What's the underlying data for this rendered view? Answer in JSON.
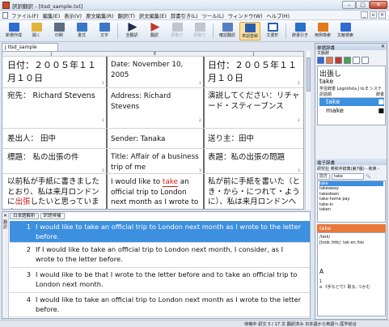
{
  "window": {
    "title": "訳訳翻訳 - [Itsd_sample.txt]",
    "min": "–",
    "max": "□",
    "close": "✕"
  },
  "menu": {
    "items": [
      "ファイル(F)",
      "編集(E)",
      "表示(V)",
      "原文編集(R)",
      "翻訳(T)",
      "訳文編集(E)",
      "辞書引き(L)",
      "ツール(L)",
      "ウィンドウ(W)",
      "ヘルプ(H)"
    ]
  },
  "toolbar": {
    "buttons": [
      {
        "label": "新規作成",
        "color": "#2f6bd1"
      },
      {
        "label": "開く",
        "color": "#e3b23c"
      },
      {
        "label": "印刷",
        "color": "#5c6c80"
      },
      {
        "label": "書式",
        "color": "#3a77c9"
      },
      {
        "label": "文字",
        "color": "#3a77c9"
      },
      {
        "label": "全翻訳",
        "color": "#1f2f4a"
      },
      {
        "label": "翻訳",
        "color": "#c23a2a"
      },
      {
        "label": "訳取り",
        "color": "#9aa3ad"
      },
      {
        "label": "訳取り",
        "color": "#9aa3ad"
      },
      {
        "label": "確認翻訳",
        "color": "#5a7ec4"
      },
      {
        "label": "単語登録",
        "color": "#2a5fb0"
      },
      {
        "label": "文書形",
        "color": "#2a5fb0"
      },
      {
        "label": "辞書引き",
        "color": "#2a6fc8"
      },
      {
        "label": "用例検索",
        "color": "#e07a1a"
      },
      {
        "label": "文献検索",
        "color": "#2f6bd1"
      }
    ]
  },
  "document": {
    "tab": "J  Itsd_sample",
    "ruler": {
      "col1": "J",
      "col2": "E",
      "col3": "J"
    },
    "segment_numbers": [
      "1",
      "1",
      "1",
      "2",
      "2",
      "2",
      "3",
      "3",
      "3"
    ],
    "rows": [
      {
        "ja": "日付：２００５年１１月１０日",
        "en": "Date:  November 10, 2005",
        "back": "日付：２００５年１１月１０日"
      },
      {
        "ja": "宛先：  Richard Stevens",
        "en": "Address:  Richard Stevens",
        "back": "演説してください：リチャード・スティーブンス"
      },
      {
        "ja": "差出人：  田中",
        "en": "Sender:  Tanaka",
        "back": "送り主：田中"
      },
      {
        "ja": "標題：  私の出張の件",
        "en": "Title:  Affair of a business trip of me",
        "back": "表題：私の出張の問題"
      },
      {
        "ja_pre": "以前私が手紙に書きましたとおり、私は来月ロンドンに",
        "ja_hl": "出張",
        "ja_post": "したいと思っています。",
        "en_pre": "I would like to ",
        "en_hl": "take",
        "en_post": " an official trip to London next month as I wrote to the letter before.",
        "back": "私が前に手紙を書いた（とき・から・につれて・ように）、私は来月ロンドンへ"
      }
    ]
  },
  "bottom": {
    "side_close": "✕",
    "side_label": "翻訳",
    "tabs": [
      "日本語解析",
      "訳語候補"
    ],
    "candidates": [
      {
        "no": "1",
        "text": "I would like to take an official trip to London next month as I wrote to the letter before.",
        "selected": true
      },
      {
        "no": "2",
        "text": "If I would like to take an official trip to London next month, I consider, as I wrote to the letter before.",
        "selected": false
      },
      {
        "no": "3",
        "text": "I would like to be that I wrote to the letter before and to take an official trip to London next month.",
        "selected": false
      },
      {
        "no": "4",
        "text": "I would like to take an official trip to London next month as I wrote to the letter before.",
        "selected": false
      }
    ]
  },
  "dict_panel": {
    "header": "単語辞書",
    "close": "✕",
    "sub": "文脈辞",
    "word_ja": "出張し",
    "word_en": "take",
    "source": "学習辞書 LogoVista J to E システ",
    "col_a": "訳語順",
    "col_b": "辞書",
    "options": [
      {
        "word": "take",
        "mark": "■",
        "selected": true
      },
      {
        "word": "make",
        "mark": "■",
        "selected": false
      }
    ]
  },
  "edict_panel": {
    "header": "電子辞書",
    "row1": "研究社 英和中辞典(第7版) - 和英 -",
    "mode": "前方",
    "query": "take",
    "list": [
      "take",
      "takeaway",
      "takedown",
      "take-home pay",
      "take-in",
      "taken"
    ],
    "bar_word": "take",
    "pron": "/téɪk/",
    "forms": "[took /tʊ́k/; tak·en /téɪ",
    "sense_head": "A",
    "sense_1": "1",
    "sense_1_text": "a 《手などで》取る, つかむ"
  },
  "status": {
    "text": "待機中  訳文  5 / 17 文  翻訳済み  日本語から英語へ  医学総合"
  }
}
